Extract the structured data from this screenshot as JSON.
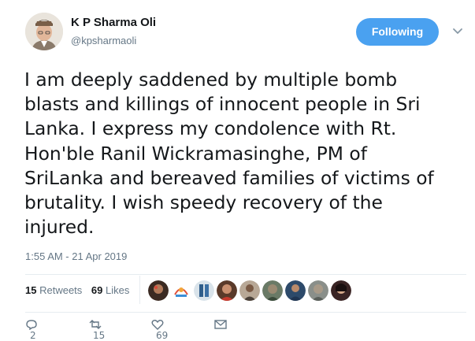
{
  "author": {
    "name": "K P Sharma Oli",
    "handle": "@kpsharmaoli"
  },
  "follow_button": {
    "label": "Following"
  },
  "tweet": {
    "lines": [
      "I am deeply saddened by multiple bomb",
      "blasts and killings of innocent people in Sri",
      "Lanka. I express my condolence with Rt.",
      "Hon'ble Ranil Wickramasinghe, PM of",
      "SriLanka and bereaved families of victims of",
      "brutality. I wish speedy recovery of the",
      "injured."
    ],
    "timestamp": "1:55 AM - 21 Apr 2019"
  },
  "stats": {
    "retweets_count": "15",
    "retweets_label": "Retweets",
    "likes_count": "69",
    "likes_label": "Likes"
  },
  "icons": {
    "chevron": "chevron-down-icon",
    "reply": "reply-icon",
    "retweet": "retweet-icon",
    "like": "heart-icon",
    "message": "envelope-icon"
  },
  "actions": {
    "reply_count": "2",
    "retweet_count": "15",
    "like_count": "69"
  },
  "colors": {
    "accent": "#4aa1f0",
    "text": "#14171a",
    "muted": "#657786"
  }
}
